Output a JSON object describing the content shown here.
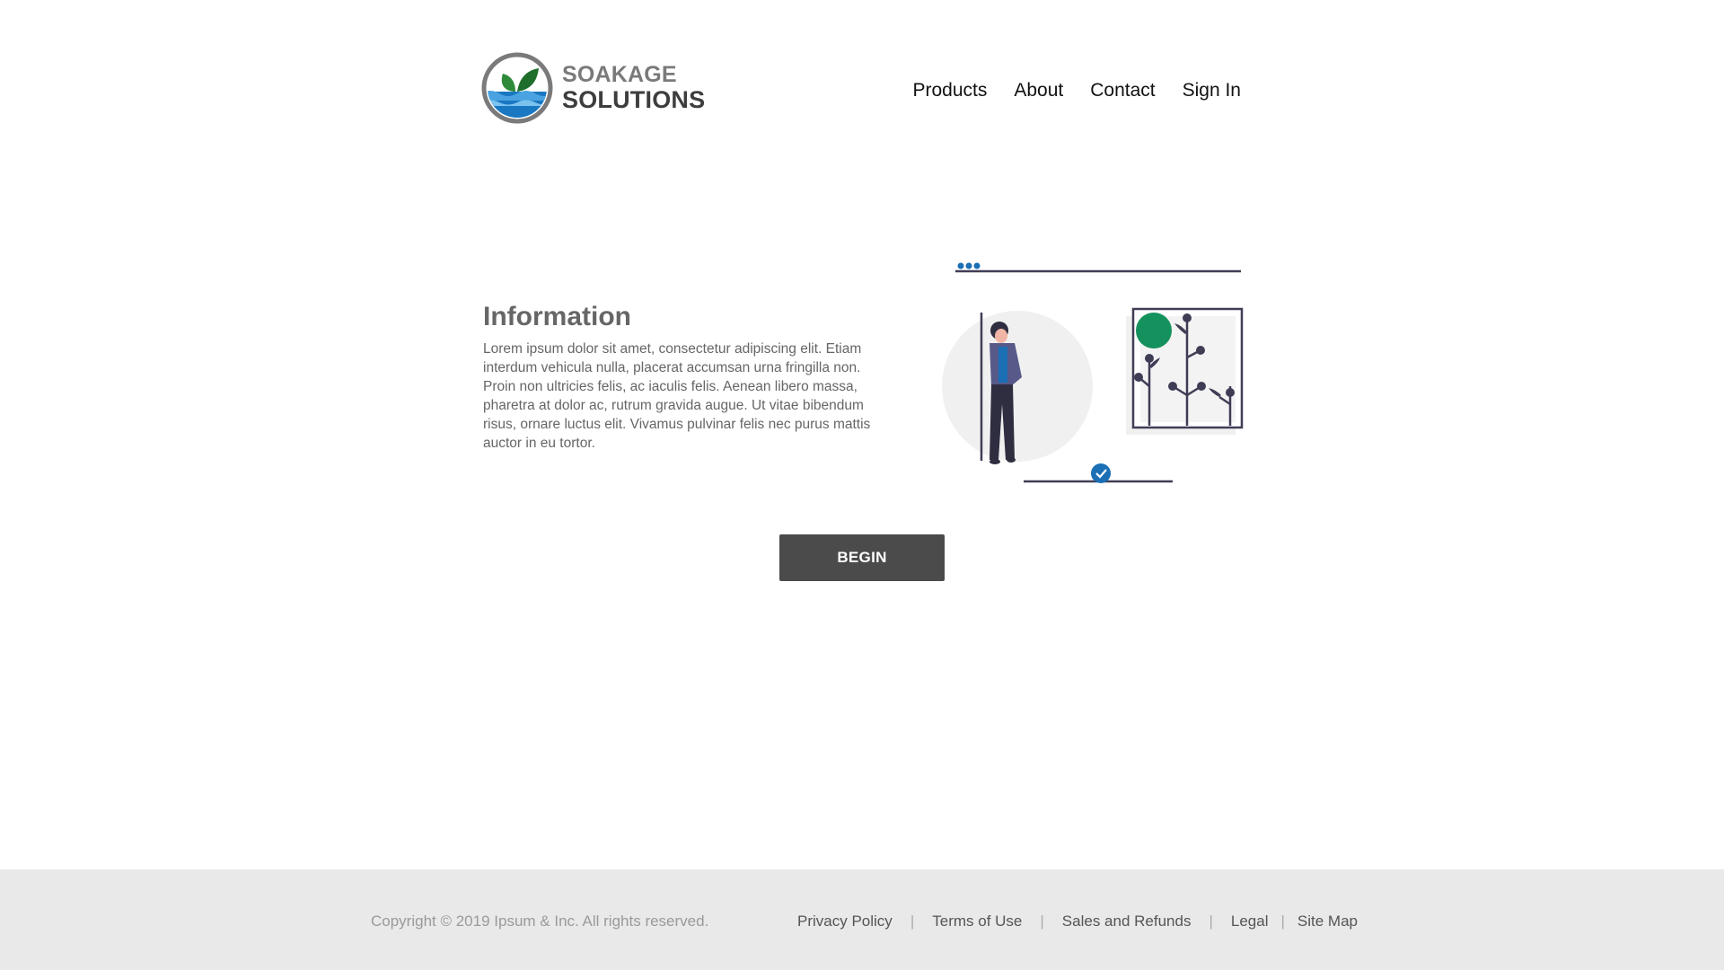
{
  "brand": {
    "line1": "SOAKAGE",
    "line2": "SOLUTIONS",
    "icon": "leaf-water-logo",
    "colors": {
      "leaf": "#2e8b3a",
      "water": "#1a78c2",
      "ring": "#7a7a7a"
    }
  },
  "nav": {
    "items": [
      {
        "label": "Products"
      },
      {
        "label": "About"
      },
      {
        "label": "Contact"
      },
      {
        "label": "Sign In"
      }
    ]
  },
  "info": {
    "title": "Information",
    "body": "Lorem ipsum dolor sit amet, consectetur adipiscing elit. Etiam interdum vehicula nulla, placerat accumsan urna fringilla non. Proin non ultricies felis, ac iaculis felis. Aenean libero massa, pharetra at dolor ac, rutrum gravida augue. Ut vitae bibendum risus, ornare luctus elit. Vivamus pulvinar felis nec purus mattis auctor in eu tortor."
  },
  "illustration": {
    "icon": "person-leaning-with-plant-frame",
    "colors": {
      "accent_blue": "#1a6fb5",
      "accent_green": "#14915c",
      "dark": "#3f3d56",
      "bg_circle": "#f0f0f0"
    }
  },
  "cta": {
    "label": "BEGIN",
    "color": "#4b4b4b"
  },
  "footer": {
    "copyright": "Copyright © 2019 Ipsum & Inc. All rights reserved.",
    "links": [
      {
        "label": "Privacy Policy"
      },
      {
        "label": "Terms of Use"
      },
      {
        "label": "Sales and Refunds"
      },
      {
        "label": "Legal"
      },
      {
        "label": "Site Map"
      }
    ],
    "separator": "|"
  }
}
